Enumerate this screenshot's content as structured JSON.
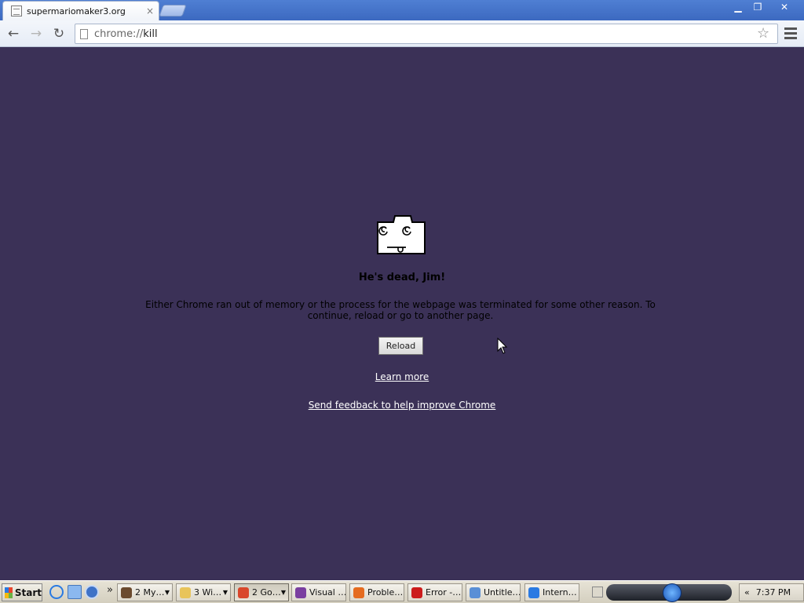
{
  "browser": {
    "tab_title": "supermariomaker3.org",
    "tab_close": "×",
    "window_buttons": {
      "minimize": "▁",
      "maximize": "❐",
      "close": "✕"
    },
    "nav": {
      "back": "←",
      "forward": "→",
      "reload": "↻"
    },
    "url_scheme": "chrome://",
    "url_host": "kill",
    "star": "☆"
  },
  "page": {
    "heading": "He's dead, Jim!",
    "message": "Either Chrome ran out of memory or the process for the webpage was terminated for some other reason.  To continue, reload or go to another page.",
    "reload_label": "Reload",
    "learn_more": "Learn more",
    "feedback": "Send feedback to help improve Chrome"
  },
  "taskbar": {
    "start_label": "Start",
    "quick_launch_more": "»",
    "tasks": [
      {
        "label": "2 My…",
        "icon": "explorer-icon",
        "color": "#6b4a2e",
        "dropdown": true
      },
      {
        "label": "3 Wi…",
        "icon": "folder-icon",
        "color": "#e8c45a",
        "dropdown": true
      },
      {
        "label": "2 Go…",
        "icon": "chrome-icon",
        "color": "#d9472b",
        "dropdown": true,
        "active": true
      },
      {
        "label": "Visual …",
        "icon": "visual-studio-icon",
        "color": "#7a3fa0",
        "dropdown": false
      },
      {
        "label": "Proble…",
        "icon": "firefox-icon",
        "color": "#e56b1f",
        "dropdown": false
      },
      {
        "label": "Error -…",
        "icon": "opera-icon",
        "color": "#cc1b1b",
        "dropdown": false
      },
      {
        "label": "Untitle…",
        "icon": "notepad-icon",
        "color": "#5a8fd6",
        "dropdown": false
      },
      {
        "label": "Intern…",
        "icon": "internet-explorer-icon",
        "color": "#2a7ae2",
        "dropdown": false
      }
    ],
    "tray_chevron": "«",
    "clock": "7:37 PM"
  }
}
